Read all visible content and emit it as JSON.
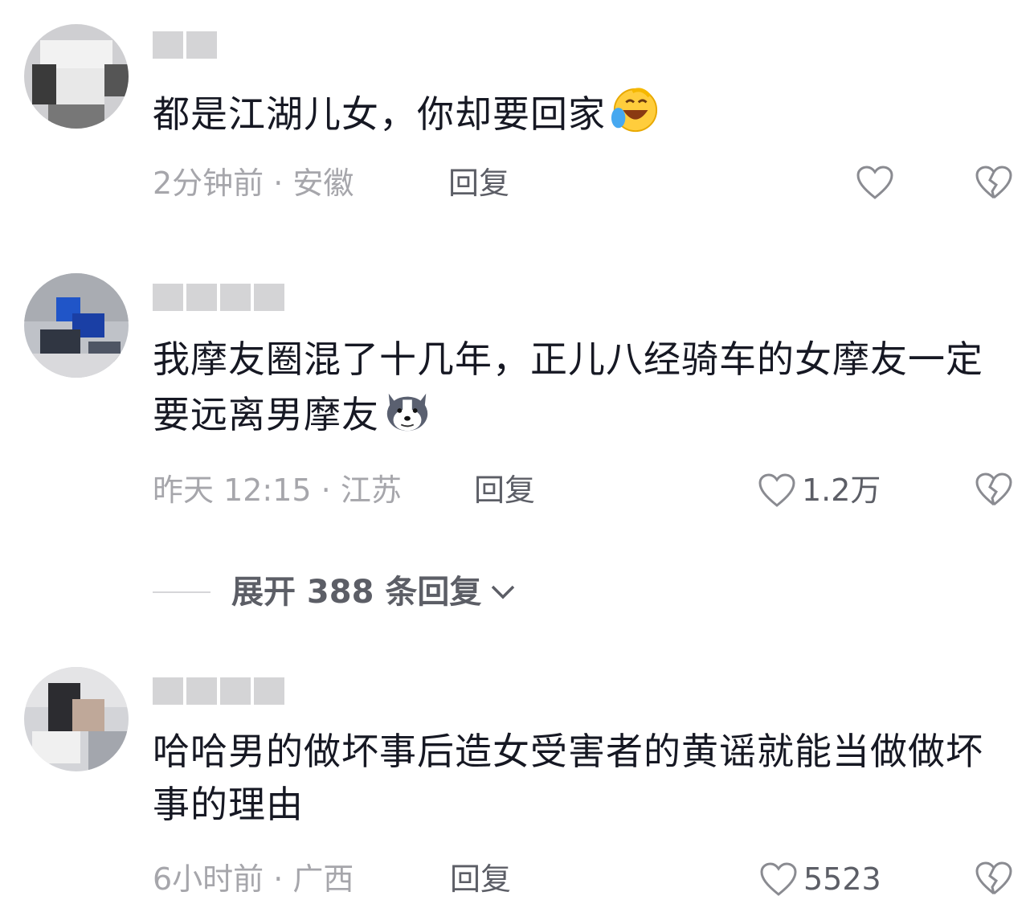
{
  "comments": [
    {
      "content": "都是江湖儿女，你却要回家",
      "emoji": "laughing-crying-emoji",
      "meta": "2分钟前 · 安徽",
      "reply_label": "回复",
      "like_count": "",
      "like_icon": "heart-outline-icon",
      "dislike_icon": "broken-heart-icon"
    },
    {
      "content": "我摩友圈混了十几年，正儿八经骑车的女摩友一定要远离男摩友",
      "emoji": "husky-emoji",
      "meta": "昨天 12:15 · 江苏",
      "reply_label": "回复",
      "like_count": "1.2万",
      "like_icon": "heart-outline-icon",
      "dislike_icon": "broken-heart-icon"
    },
    {
      "content": "哈哈男的做坏事后造女受害者的黄谣就能当做做坏事的理由",
      "meta": "6小时前 · 广西",
      "reply_label": "回复",
      "like_count": "5523",
      "like_icon": "heart-outline-icon",
      "dislike_icon": "broken-heart-icon"
    }
  ],
  "expand_replies": {
    "label": "展开 388 条回复",
    "icon": "chevron-down-icon"
  },
  "colors": {
    "text_primary": "#161823",
    "text_secondary": "#a6a6ab",
    "action": "#5c5e66"
  }
}
